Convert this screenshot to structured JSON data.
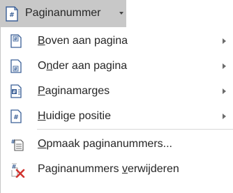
{
  "ribbon": {
    "label": "Paginanummer"
  },
  "menu": {
    "items": [
      {
        "pre": "",
        "key": "B",
        "post": "oven aan pagina",
        "submenu": true
      },
      {
        "pre": "O",
        "key": "n",
        "post": "der aan pagina",
        "submenu": true
      },
      {
        "pre": "",
        "key": "P",
        "post": "aginamarges",
        "submenu": true
      },
      {
        "pre": "",
        "key": "H",
        "post": "uidige positie",
        "submenu": true
      },
      {
        "pre": "",
        "key": "O",
        "post": "pmaak paginanummers...",
        "submenu": false
      },
      {
        "pre": "Paginanummers ",
        "key": "v",
        "post": "erwijderen",
        "submenu": false
      }
    ]
  },
  "icons": {
    "ribbon": "page-number-icon",
    "item0": "page-top-icon",
    "item1": "page-bottom-icon",
    "item2": "page-margins-icon",
    "item3": "current-position-icon",
    "item4": "format-page-numbers-icon",
    "item5": "remove-page-numbers-icon"
  },
  "colors": {
    "ribbon_bg": "#c8c8c8",
    "icon_blue": "#2b579a",
    "remove_red": "#d1342f",
    "text": "#262626"
  }
}
